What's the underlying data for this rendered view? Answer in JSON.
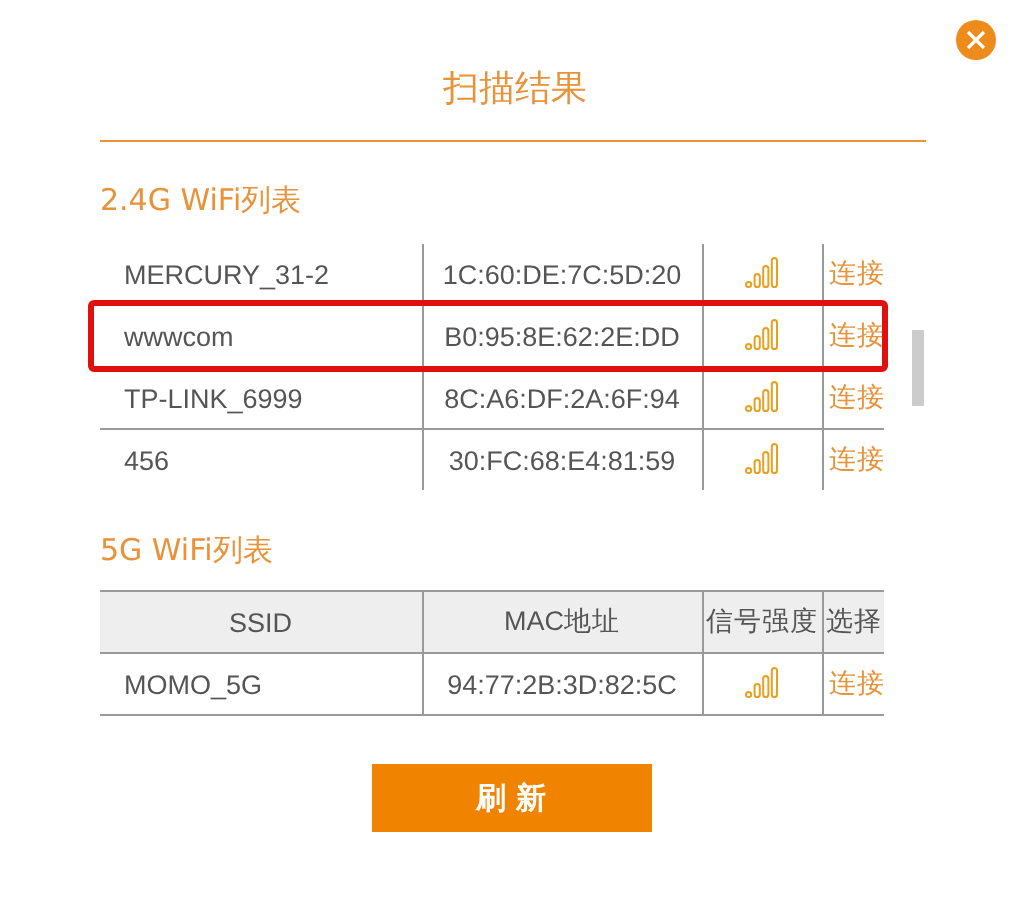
{
  "dialog": {
    "title": "扫描结果"
  },
  "sections": [
    {
      "heading": "2.4G WiFi列表",
      "table": {
        "rows": [
          {
            "ssid": "MERCURY_31-2",
            "mac": "1C:60:DE:7C:5D:20",
            "action": "连接",
            "highlighted": false
          },
          {
            "ssid": "wwwcom",
            "mac": "B0:95:8E:62:2E:DD",
            "action": "连接",
            "highlighted": true
          },
          {
            "ssid": "TP-LINK_6999",
            "mac": "8C:A6:DF:2A:6F:94",
            "action": "连接",
            "highlighted": false
          },
          {
            "ssid": "456",
            "mac": "30:FC:68:E4:81:59",
            "action": "连接",
            "highlighted": false
          }
        ]
      }
    },
    {
      "heading": "5G WiFi列表",
      "table": {
        "columns": [
          "SSID",
          "MAC地址",
          "信号强度",
          "选择"
        ],
        "rows": [
          {
            "ssid": "MOMO_5G",
            "mac": "94:77:2B:3D:82:5C",
            "action": "连接",
            "highlighted": false
          }
        ]
      }
    }
  ],
  "buttons": [
    "刷 新"
  ]
}
